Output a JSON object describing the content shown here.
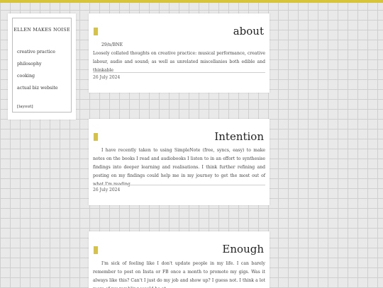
{
  "sidebar": {
    "title": "ELLEN MAKES NOISE",
    "items": [
      {
        "label": "creative practice"
      },
      {
        "label": "philosophy"
      },
      {
        "label": "cooking"
      },
      {
        "label": "actual biz website"
      }
    ],
    "layout_label": "[layout]"
  },
  "posts": [
    {
      "title": "about",
      "location": "29/n/BNE",
      "body": "Loosely collated thoughts on creative practice: musical performance, creative labour, audio and sound; as well as unrelated miscellanies both edible and thinkable",
      "date": "26 July 2024"
    },
    {
      "title": "Intention",
      "body": "I have recently taken to using SimpleNote (free, syncs, easy) to make notes on the books I read and audiobooks I listen to in an effort to synthesise findings into deeper learning and realisations. I think further refining and posting on my findings could help me in my journey to get the most out of what I'm reading.",
      "date": "26 July 2024"
    },
    {
      "title": "Enough",
      "body": "I'm sick of feeling like I don't update people in my life. I can barely remember to post on Insta or FB once a month to promote my gigs. Was it always like this? Can't I just do my job and show up? I guess not. I think a lot more of my rambling would be at"
    }
  ],
  "colors": {
    "accent": "#d4c24a",
    "top_bar": "#d8c43a",
    "background": "#e9e9e9"
  }
}
